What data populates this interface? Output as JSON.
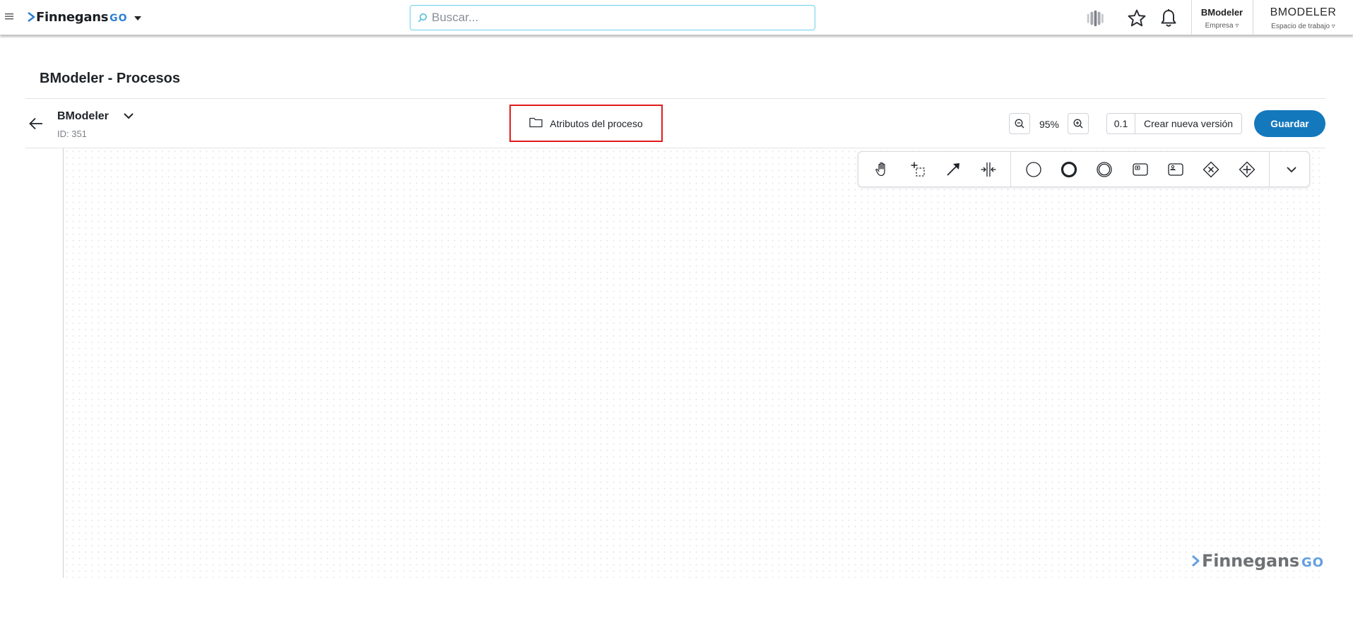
{
  "topbar": {
    "logo": {
      "word": "Finnegans",
      "suffix": "GO"
    },
    "search": {
      "placeholder": "Buscar..."
    },
    "company": {
      "name": "BModeler",
      "label": "Empresa ▿"
    },
    "workspace": {
      "name": "BMODELER",
      "label": "Espacio de trabajo ▿"
    },
    "icons": [
      "menu-icon",
      "apps-icon",
      "star-icon",
      "bell-icon"
    ]
  },
  "page": {
    "title": "BModeler - Procesos"
  },
  "process": {
    "name": "BModeler",
    "id_label": "ID: 351",
    "attributes_label": "Atributos del proceso"
  },
  "toolbar": {
    "zoom_level": "95%",
    "version": "0.1",
    "new_version_label": "Crear nueva versión",
    "save_label": "Guardar"
  },
  "palette": {
    "tools": [
      "hand-tool",
      "lasso-tool",
      "connect-tool",
      "space-tool"
    ],
    "shapes": [
      "start-event",
      "end-event",
      "intermediate-event",
      "task",
      "user-task",
      "exclusive-gateway",
      "parallel-gateway"
    ]
  },
  "watermark": {
    "word": "Finnegans",
    "suffix": "GO"
  },
  "colors": {
    "accent": "#1478bd",
    "highlight": "#e21c1c",
    "search_border": "#6ad1e6",
    "brand_go": "#2f7fd6"
  }
}
